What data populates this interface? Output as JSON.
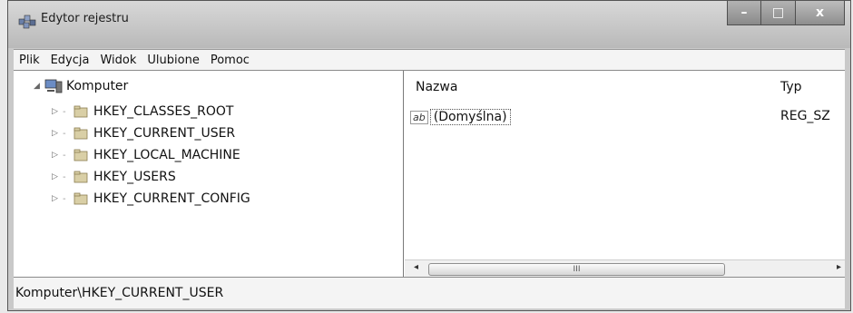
{
  "window": {
    "title": "Edytor rejestru",
    "controls": {
      "minimize": "–",
      "maximize": "□",
      "close": "x"
    }
  },
  "menu": [
    "Plik",
    "Edycja",
    "Widok",
    "Ulubione",
    "Pomoc"
  ],
  "tree": {
    "root": "Komputer",
    "children": [
      "HKEY_CLASSES_ROOT",
      "HKEY_CURRENT_USER",
      "HKEY_LOCAL_MACHINE",
      "HKEY_USERS",
      "HKEY_CURRENT_CONFIG"
    ]
  },
  "list": {
    "columns": {
      "name": "Nazwa",
      "type": "Typ"
    },
    "rows": [
      {
        "icon": "ab",
        "name": "(Domyślna)",
        "type": "REG_SZ"
      }
    ]
  },
  "scrollbar": {
    "thumb_grip": "III",
    "left_arrow": "◂",
    "right_arrow": "▸"
  },
  "status_path": "Komputer\\HKEY_CURRENT_USER"
}
